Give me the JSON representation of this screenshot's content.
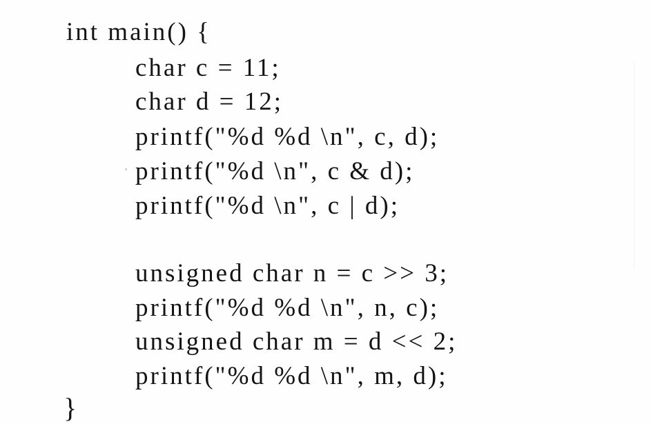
{
  "document": {
    "language": "C",
    "lines": [
      "int main() {",
      "char c = 11;",
      "char d = 12;",
      "printf(\"%d %d \\n\", c, d);",
      "printf(\"%d \\n\", c & d);",
      "printf(\"%d \\n\", c | d);",
      "unsigned char n = c >> 3;",
      "printf(\"%d %d \\n\", n, c);",
      "unsigned char m = d << 2;",
      "printf(\"%d %d \\n\", m, d);",
      "}"
    ]
  }
}
